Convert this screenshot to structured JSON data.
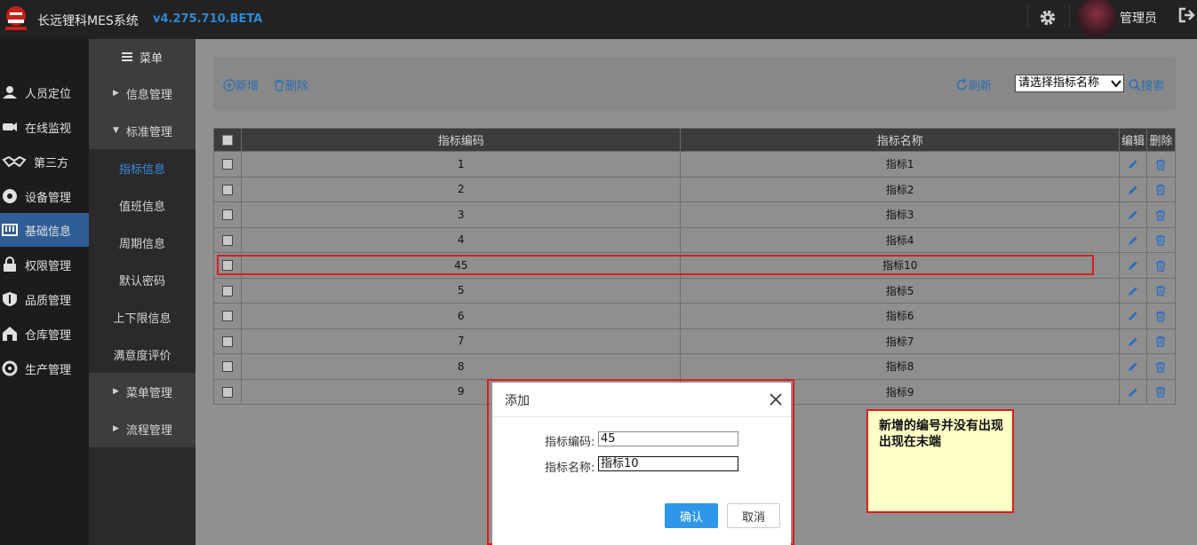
{
  "header": {
    "app_title": "长远锂科MES系统",
    "version": "v4.275.710.BETA",
    "user_name": "管理员"
  },
  "left_nav": {
    "items": [
      {
        "label": "人员定位",
        "icon": "person-location-icon",
        "active": false
      },
      {
        "label": "在线监视",
        "icon": "camera-icon",
        "active": false
      },
      {
        "label": "第三方",
        "icon": "handshake-icon",
        "active": false
      },
      {
        "label": "设备管理",
        "icon": "device-icon",
        "active": false
      },
      {
        "label": "基础信息",
        "icon": "keyboard-icon",
        "active": true
      },
      {
        "label": "权限管理",
        "icon": "lock-icon",
        "active": false
      },
      {
        "label": "品质管理",
        "icon": "shield-icon",
        "active": false
      },
      {
        "label": "仓库管理",
        "icon": "warehouse-icon",
        "active": false
      },
      {
        "label": "生产管理",
        "icon": "production-icon",
        "active": false
      }
    ]
  },
  "sub_nav": {
    "menu_label": "菜单",
    "items": [
      {
        "label": "信息管理",
        "type": "group",
        "expanded": false
      },
      {
        "label": "标准管理",
        "type": "group",
        "expanded": true
      },
      {
        "label": "指标信息",
        "type": "item",
        "selected": true
      },
      {
        "label": "值班信息",
        "type": "item",
        "selected": false
      },
      {
        "label": "周期信息",
        "type": "item",
        "selected": false
      },
      {
        "label": "默认密码",
        "type": "item",
        "selected": false
      },
      {
        "label": "上下限信息",
        "type": "item",
        "selected": false
      },
      {
        "label": "满意度评价",
        "type": "item",
        "selected": false
      },
      {
        "label": "菜单管理",
        "type": "group",
        "expanded": false
      },
      {
        "label": "流程管理",
        "type": "group",
        "expanded": false
      }
    ]
  },
  "toolbar": {
    "add_label": "新增",
    "delete_label": "删除",
    "refresh_label": "刷新",
    "select_value": "请选择指标名称",
    "search_label": "搜索"
  },
  "table": {
    "headers": {
      "code": "指标编码",
      "name": "指标名称",
      "edit": "编辑",
      "delete": "删除"
    },
    "rows": [
      {
        "code": "1",
        "name": "指标1"
      },
      {
        "code": "2",
        "name": "指标2"
      },
      {
        "code": "3",
        "name": "指标3"
      },
      {
        "code": "4",
        "name": "指标4"
      },
      {
        "code": "45",
        "name": "指标10"
      },
      {
        "code": "5",
        "name": "指标5"
      },
      {
        "code": "6",
        "name": "指标6"
      },
      {
        "code": "7",
        "name": "指标7"
      },
      {
        "code": "8",
        "name": "指标8"
      },
      {
        "code": "9",
        "name": "指标9"
      }
    ]
  },
  "dialog": {
    "title": "添加",
    "code_label": "指标编码:",
    "code_value": "45",
    "name_label": "指标名称:",
    "name_value": "指标10",
    "confirm_label": "确认",
    "cancel_label": "取消"
  },
  "annotation": {
    "note_text": "新增的编号并没有出现出现在末端"
  },
  "colors": {
    "topbar": "#222222",
    "accent_blue": "#2e96eb",
    "active_nav": "#2f5d95",
    "link_blue": "#2c6eb4",
    "highlight_red": "#d81e1e",
    "note_yellow": "#ffffc6"
  }
}
